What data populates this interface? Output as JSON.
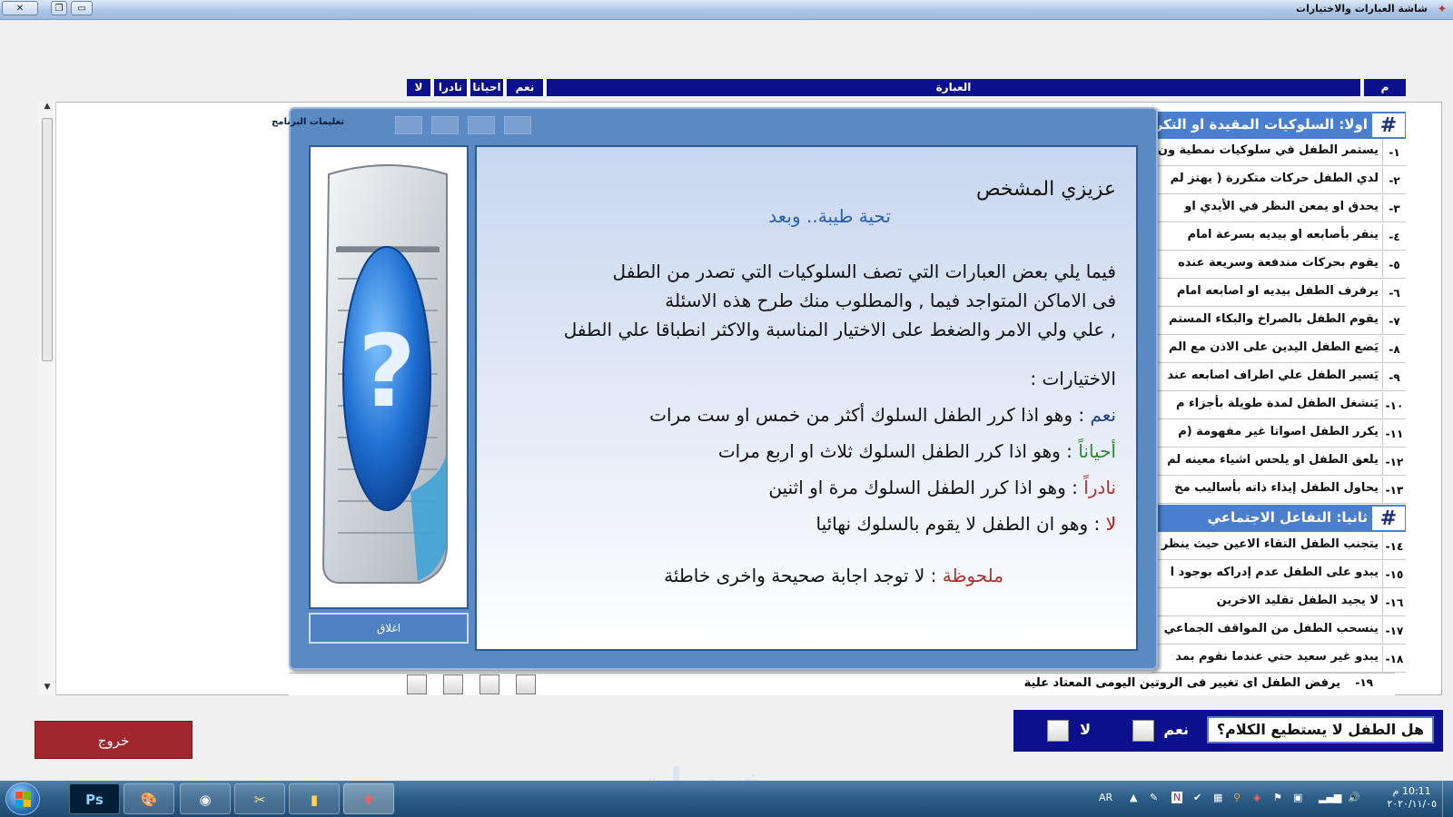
{
  "window": {
    "title": "شاشة العبارات والاختيارات"
  },
  "table": {
    "headers": {
      "num": "م",
      "statement": "العبارة",
      "yes": "نعم",
      "sometimes": "احيانا",
      "rarely": "نادرا",
      "no": "لا"
    },
    "section1": {
      "hash": "#",
      "title": "اولا: السلوكيات المقيدة او التكر"
    },
    "section2": {
      "hash": "#",
      "title": "ثانيا: التفاعل الاجتماعي"
    },
    "rows": [
      {
        "num": "-١",
        "text": "يستمر الطفل في سلوكيات نمطية ون"
      },
      {
        "num": "-٢",
        "text": "لدي الطفل حركات متكررة  ( يهتز لم"
      },
      {
        "num": "-٣",
        "text": "يحدق او  يمعن النظر في الأيدي او"
      },
      {
        "num": "-٤",
        "text": "ينقر بأصابعه او بيديه بسرعة امام"
      },
      {
        "num": "-٥",
        "text": "يقوم بحركات مندفعة وسريعة عنده"
      },
      {
        "num": "-٦",
        "text": "يرفرف الطفل بيديه او اصابعه امام"
      },
      {
        "num": "-٧",
        "text": "يقوم الطفل بالصراخ والبكاء المستم"
      },
      {
        "num": "-٨",
        "text": "يَضع الطفل اليدين على الاذن مع الم"
      },
      {
        "num": "-٩",
        "text": "يَسير الطفل علي اطراف اصابعه عند"
      },
      {
        "num": "-١٠",
        "text": "يَنشغل الطفل  لمدة طويلة بأجزاء م"
      },
      {
        "num": "-١١",
        "text": "يكرر الطفل اصواتا غير مفهومة  (م"
      },
      {
        "num": "-١٢",
        "text": "يلعق الطفل او يلحس اشياء معينه لم"
      },
      {
        "num": "-١٣",
        "text": "يحاول الطفل إيذاء ذاته بأساليب مخ"
      },
      {
        "num": "-١٤",
        "text": "يتجنب الطفل التقاء الاعين حيث ينظر"
      },
      {
        "num": "-١٥",
        "text": "يبدو على الطفل عدم إدراكه بوجود ا"
      },
      {
        "num": "-١٦",
        "text": "لا يجيد الطفل تقليد الاخرين"
      },
      {
        "num": "-١٧",
        "text": "ينسحب الطفل  من المواقف الجماعي"
      },
      {
        "num": "-١٨",
        "text": "يبدو غير سعيد حتي عندما نقوم بمد"
      }
    ],
    "last_row": {
      "num": "-١٩",
      "text": "يرفض الطفل  اى تغيير فى الروتين اليومى المعتاد علية"
    }
  },
  "dialog": {
    "title": "تعليمات البرنامج",
    "close_label": "اغلاق",
    "greeting": "عزيزي المشخص",
    "salutation": "تحية طيبة.. وبعد",
    "body_line1": "فيما يلي بعض العبارات  التي تصف السلوكيات التي  تصدر من الطفل",
    "body_line2": "فى الاماكن المتواجد فيما , والمطلوب منك طرح هذه الاسئلة",
    "body_line3": ", علي ولي الامر والضغط على الاختيار المناسبة  والاكثر انطباقا علي الطفل",
    "choices_title": "الاختيارات :",
    "choices": [
      {
        "key": "نعم",
        "desc": " :  وهو اذا كرر الطفل السلوك أكثر من  خمس او ست مرات",
        "color": "#1f3f8a"
      },
      {
        "key": "أحياناً",
        "desc": " : وهو اذا كرر الطفل السلوك  ثلاث او اربع مرات",
        "color": "#2e8a2e"
      },
      {
        "key": "نادراً",
        "desc": "  :  وهو  اذا كرر الطفل السلوك مرة او اثنين",
        "color": "#b0322f"
      },
      {
        "key": "لا",
        "desc": "        : وهو ان الطفل لا يقوم بالسلوك نهائيا",
        "color": "#cc1111"
      }
    ],
    "note_key": "ملحوظة",
    "note_text": " :  لا توجد اجابة صحيحة واخرى خاطئة",
    "note_color": "#b0322f",
    "salutation_color": "#2b5fb0"
  },
  "bottom": {
    "exit_label": "خروج",
    "question": "هل الطفل لا يستطيع الكلام؟",
    "yes_label": "نعم",
    "no_label": "لا"
  },
  "taskbar": {
    "lang": "AR",
    "time": "10:11 م",
    "date": "٢٠٢٠/١١/٠٥",
    "apps": [
      "Ps",
      "paint-icon",
      "chrome-icon",
      "tools-icon",
      "folder-icon",
      "puzzle-icon"
    ]
  },
  "watermark": "خمسات"
}
